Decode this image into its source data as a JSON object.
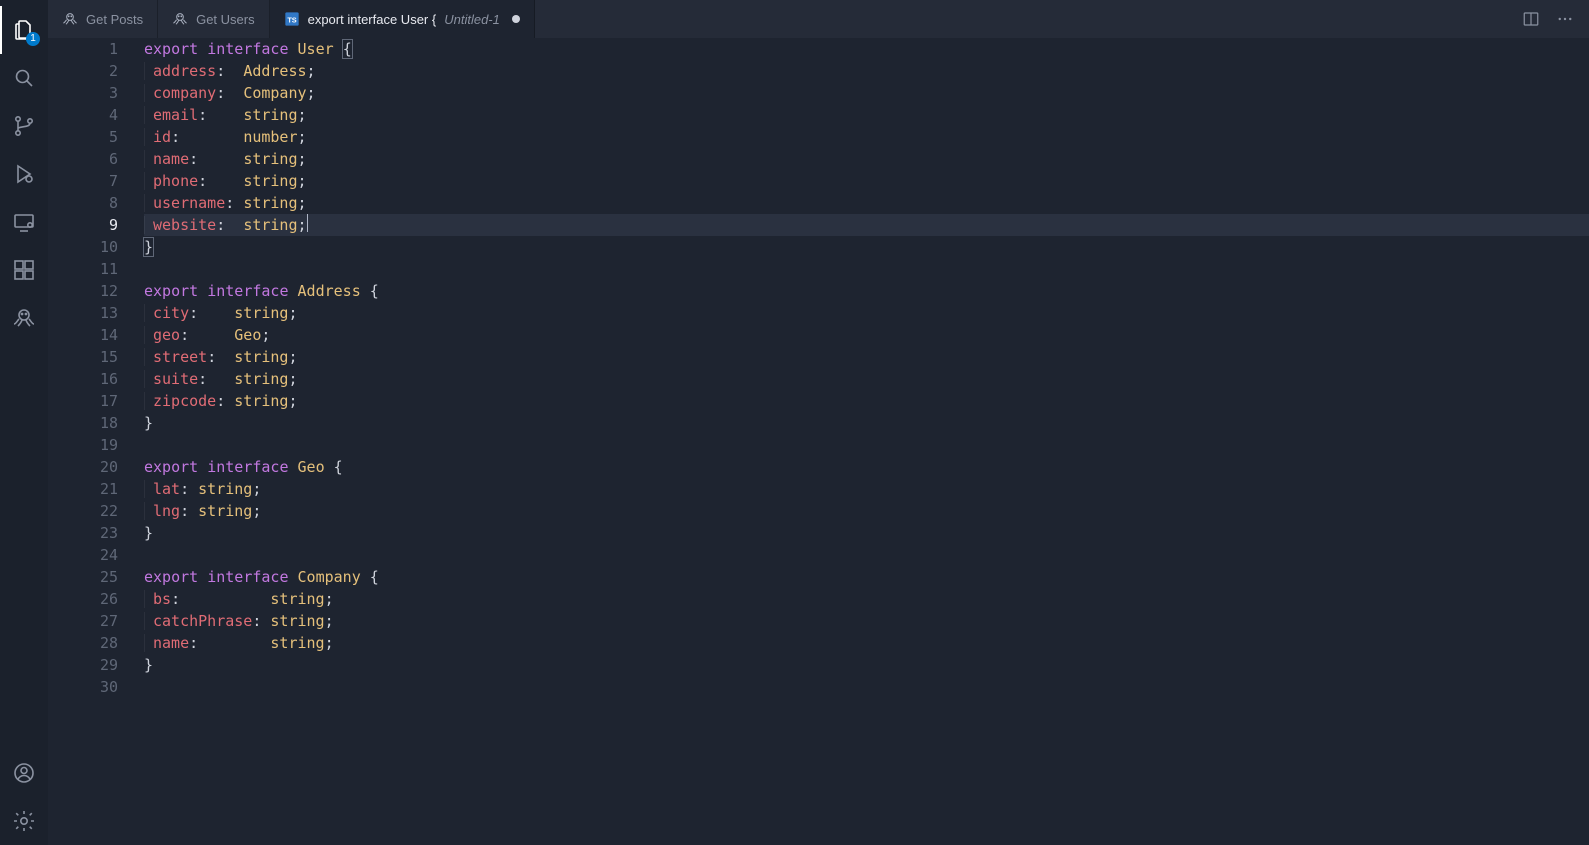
{
  "activity_bar": {
    "explorer_badge": "1"
  },
  "tabs": [
    {
      "icon": "octopus",
      "label": "Get Posts",
      "sublabel": "",
      "active": false,
      "dirty": false
    },
    {
      "icon": "octopus",
      "label": "Get Users",
      "sublabel": "",
      "active": false,
      "dirty": false
    },
    {
      "icon": "ts",
      "label": "export interface User {",
      "sublabel": "Untitled-1",
      "active": true,
      "dirty": true
    }
  ],
  "editor": {
    "current_line_index": 8,
    "lines": [
      {
        "n": 1,
        "tokens": [
          [
            "kw",
            "export"
          ],
          [
            "p",
            " "
          ],
          [
            "kw",
            "interface"
          ],
          [
            "p",
            " "
          ],
          [
            "type",
            "User"
          ],
          [
            "p",
            " "
          ],
          [
            "p",
            "{",
            "match"
          ]
        ]
      },
      {
        "n": 2,
        "indent": true,
        "tokens": [
          [
            "prop",
            "address"
          ],
          [
            "p",
            ":  "
          ],
          [
            "type",
            "Address"
          ],
          [
            "p",
            ";"
          ]
        ]
      },
      {
        "n": 3,
        "indent": true,
        "tokens": [
          [
            "prop",
            "company"
          ],
          [
            "p",
            ":  "
          ],
          [
            "type",
            "Company"
          ],
          [
            "p",
            ";"
          ]
        ]
      },
      {
        "n": 4,
        "indent": true,
        "tokens": [
          [
            "prop",
            "email"
          ],
          [
            "p",
            ":    "
          ],
          [
            "type",
            "string"
          ],
          [
            "p",
            ";"
          ]
        ]
      },
      {
        "n": 5,
        "indent": true,
        "tokens": [
          [
            "prop",
            "id"
          ],
          [
            "p",
            ":       "
          ],
          [
            "type",
            "number"
          ],
          [
            "p",
            ";"
          ]
        ]
      },
      {
        "n": 6,
        "indent": true,
        "tokens": [
          [
            "prop",
            "name"
          ],
          [
            "p",
            ":     "
          ],
          [
            "type",
            "string"
          ],
          [
            "p",
            ";"
          ]
        ]
      },
      {
        "n": 7,
        "indent": true,
        "tokens": [
          [
            "prop",
            "phone"
          ],
          [
            "p",
            ":    "
          ],
          [
            "type",
            "string"
          ],
          [
            "p",
            ";"
          ]
        ]
      },
      {
        "n": 8,
        "indent": true,
        "tokens": [
          [
            "prop",
            "username"
          ],
          [
            "p",
            ": "
          ],
          [
            "type",
            "string"
          ],
          [
            "p",
            ";"
          ]
        ]
      },
      {
        "n": 9,
        "indent": true,
        "current": true,
        "tokens": [
          [
            "prop",
            "website"
          ],
          [
            "p",
            ":  "
          ],
          [
            "type",
            "string"
          ],
          [
            "p",
            ";"
          ],
          [
            "cursor",
            ""
          ]
        ]
      },
      {
        "n": 10,
        "tokens": [
          [
            "p",
            "}",
            "match"
          ]
        ]
      },
      {
        "n": 11,
        "tokens": []
      },
      {
        "n": 12,
        "tokens": [
          [
            "kw",
            "export"
          ],
          [
            "p",
            " "
          ],
          [
            "kw",
            "interface"
          ],
          [
            "p",
            " "
          ],
          [
            "type",
            "Address"
          ],
          [
            "p",
            " {"
          ]
        ]
      },
      {
        "n": 13,
        "indent": true,
        "tokens": [
          [
            "prop",
            "city"
          ],
          [
            "p",
            ":    "
          ],
          [
            "type",
            "string"
          ],
          [
            "p",
            ";"
          ]
        ]
      },
      {
        "n": 14,
        "indent": true,
        "tokens": [
          [
            "prop",
            "geo"
          ],
          [
            "p",
            ":     "
          ],
          [
            "type",
            "Geo"
          ],
          [
            "p",
            ";"
          ]
        ]
      },
      {
        "n": 15,
        "indent": true,
        "tokens": [
          [
            "prop",
            "street"
          ],
          [
            "p",
            ":  "
          ],
          [
            "type",
            "string"
          ],
          [
            "p",
            ";"
          ]
        ]
      },
      {
        "n": 16,
        "indent": true,
        "tokens": [
          [
            "prop",
            "suite"
          ],
          [
            "p",
            ":   "
          ],
          [
            "type",
            "string"
          ],
          [
            "p",
            ";"
          ]
        ]
      },
      {
        "n": 17,
        "indent": true,
        "tokens": [
          [
            "prop",
            "zipcode"
          ],
          [
            "p",
            ": "
          ],
          [
            "type",
            "string"
          ],
          [
            "p",
            ";"
          ]
        ]
      },
      {
        "n": 18,
        "tokens": [
          [
            "p",
            "}"
          ]
        ]
      },
      {
        "n": 19,
        "tokens": []
      },
      {
        "n": 20,
        "tokens": [
          [
            "kw",
            "export"
          ],
          [
            "p",
            " "
          ],
          [
            "kw",
            "interface"
          ],
          [
            "p",
            " "
          ],
          [
            "type",
            "Geo"
          ],
          [
            "p",
            " {"
          ]
        ]
      },
      {
        "n": 21,
        "indent": true,
        "tokens": [
          [
            "prop",
            "lat"
          ],
          [
            "p",
            ": "
          ],
          [
            "type",
            "string"
          ],
          [
            "p",
            ";"
          ]
        ]
      },
      {
        "n": 22,
        "indent": true,
        "tokens": [
          [
            "prop",
            "lng"
          ],
          [
            "p",
            ": "
          ],
          [
            "type",
            "string"
          ],
          [
            "p",
            ";"
          ]
        ]
      },
      {
        "n": 23,
        "tokens": [
          [
            "p",
            "}"
          ]
        ]
      },
      {
        "n": 24,
        "tokens": []
      },
      {
        "n": 25,
        "tokens": [
          [
            "kw",
            "export"
          ],
          [
            "p",
            " "
          ],
          [
            "kw",
            "interface"
          ],
          [
            "p",
            " "
          ],
          [
            "type",
            "Company"
          ],
          [
            "p",
            " {"
          ]
        ]
      },
      {
        "n": 26,
        "indent": true,
        "tokens": [
          [
            "prop",
            "bs"
          ],
          [
            "p",
            ":          "
          ],
          [
            "type",
            "string"
          ],
          [
            "p",
            ";"
          ]
        ]
      },
      {
        "n": 27,
        "indent": true,
        "tokens": [
          [
            "prop",
            "catchPhrase"
          ],
          [
            "p",
            ": "
          ],
          [
            "type",
            "string"
          ],
          [
            "p",
            ";"
          ]
        ]
      },
      {
        "n": 28,
        "indent": true,
        "tokens": [
          [
            "prop",
            "name"
          ],
          [
            "p",
            ":        "
          ],
          [
            "type",
            "string"
          ],
          [
            "p",
            ";"
          ]
        ]
      },
      {
        "n": 29,
        "tokens": [
          [
            "p",
            "}"
          ]
        ]
      },
      {
        "n": 30,
        "tokens": []
      }
    ]
  }
}
